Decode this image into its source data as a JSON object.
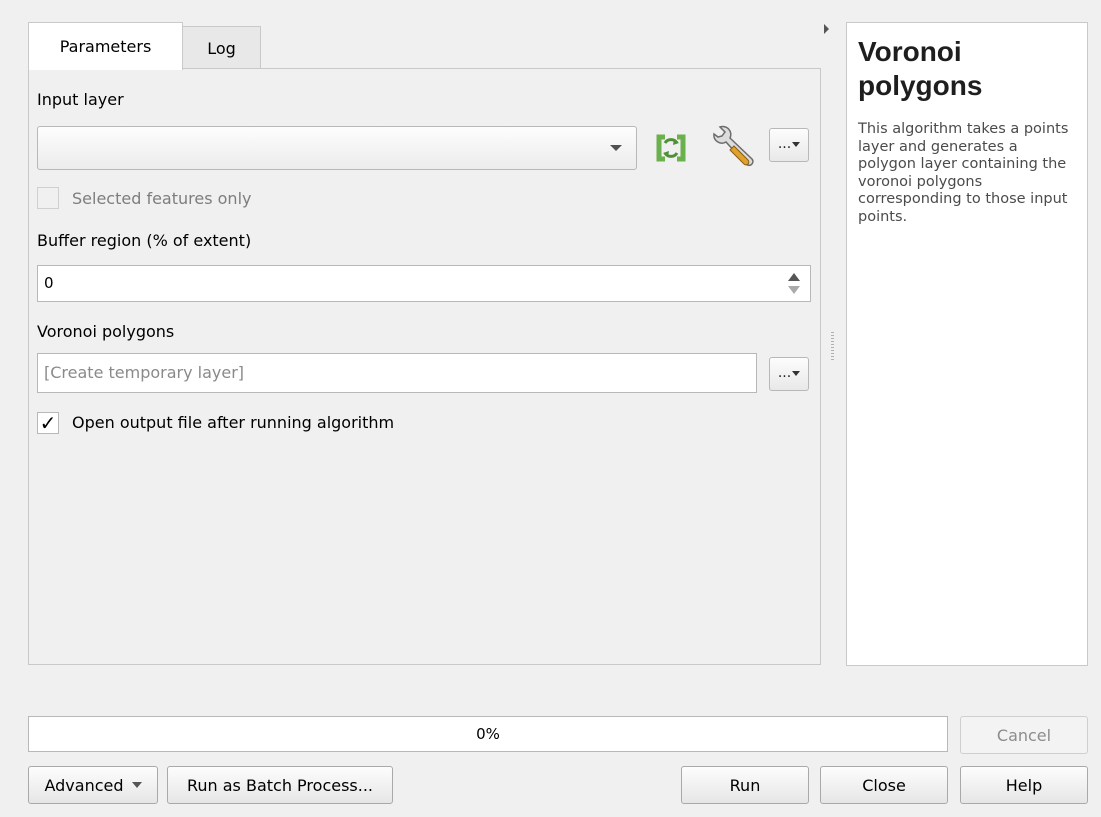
{
  "tabs": [
    {
      "label": "Parameters",
      "active": true
    },
    {
      "label": "Log",
      "active": false
    }
  ],
  "params": {
    "input_layer": {
      "label": "Input layer",
      "value": ""
    },
    "selected_only": {
      "label": "Selected features only",
      "checked": false,
      "enabled": false
    },
    "buffer": {
      "label": "Buffer region (% of extent)",
      "value": "0"
    },
    "output": {
      "label": "Voronoi polygons",
      "placeholder": "[Create temporary layer]"
    },
    "open_output": {
      "label": "Open output file after running algorithm",
      "checked": true,
      "check_glyph": "✓"
    },
    "dots_label": "..."
  },
  "icons": {
    "iterate": "iterate-features-icon",
    "wrench": "wrench-icon"
  },
  "colors": {
    "iterate_green": "#6ab04c",
    "wrench_handle": "#e0a22e"
  },
  "help": {
    "title": "Voronoi polygons",
    "text": "This algorithm takes a points layer and generates a polygon layer containing the voronoi polygons corresponding to those input points."
  },
  "progress": {
    "value": 0,
    "label": "0%"
  },
  "buttons": {
    "cancel": "Cancel",
    "advanced": "Advanced",
    "batch": "Run as Batch Process...",
    "run": "Run",
    "close": "Close",
    "help": "Help"
  }
}
